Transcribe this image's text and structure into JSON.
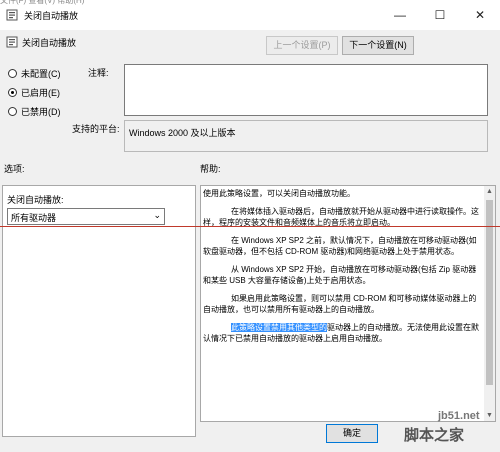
{
  "window": {
    "title": "关闭自动播放",
    "minimize": "—",
    "maximize": "☐",
    "close": "✕",
    "ghost_menu": "文件(F)    查看(V)    帮助(H)"
  },
  "header": {
    "policy_name": "关闭自动播放",
    "prev_label": "上一个设置(P)",
    "next_label": "下一个设置(N)"
  },
  "options": {
    "not_configured": "未配置(C)",
    "enabled": "已启用(E)",
    "disabled": "已禁用(D)",
    "selected": "enabled"
  },
  "comment_label": "注释:",
  "platform_label": "支持的平台:",
  "platform_value": "Windows 2000 及以上版本",
  "options_heading": "选项:",
  "help_heading": "帮助:",
  "left": {
    "field_label": "关闭自动播放:",
    "select_value": "所有驱动器"
  },
  "help": {
    "p1": "使用此策略设置，可以关闭自动播放功能。",
    "p2": "在将媒体插入驱动器后，自动播放就开始从驱动器中进行读取操作。这样，程序的安装文件和音频媒体上的音乐将立即启动。",
    "p3": "在 Windows XP SP2 之前，默认情况下，自动播放在可移动驱动器(如软盘驱动器，但不包括 CD-ROM 驱动器)和网络驱动器上处于禁用状态。",
    "p4": "从 Windows XP SP2 开始，自动播放在可移动驱动器(包括 Zip 驱动器和某些 USB 大容量存储设备)上处于启用状态。",
    "p5": "如果启用此策略设置，则可以禁用 CD-ROM 和可移动媒体驱动器上的自动播放，也可以禁用所有驱动器上的自动播放。",
    "p6_highlight": "此策略设置禁用其他类型的",
    "p6_rest": "驱动器上的自动播放。无法使用此设置在默认情况下已禁用自动播放的驱动器上启用自动播放。"
  },
  "ok_label": "确定",
  "watermark": {
    "url": "jb51.net",
    "text": "脚本之家"
  }
}
